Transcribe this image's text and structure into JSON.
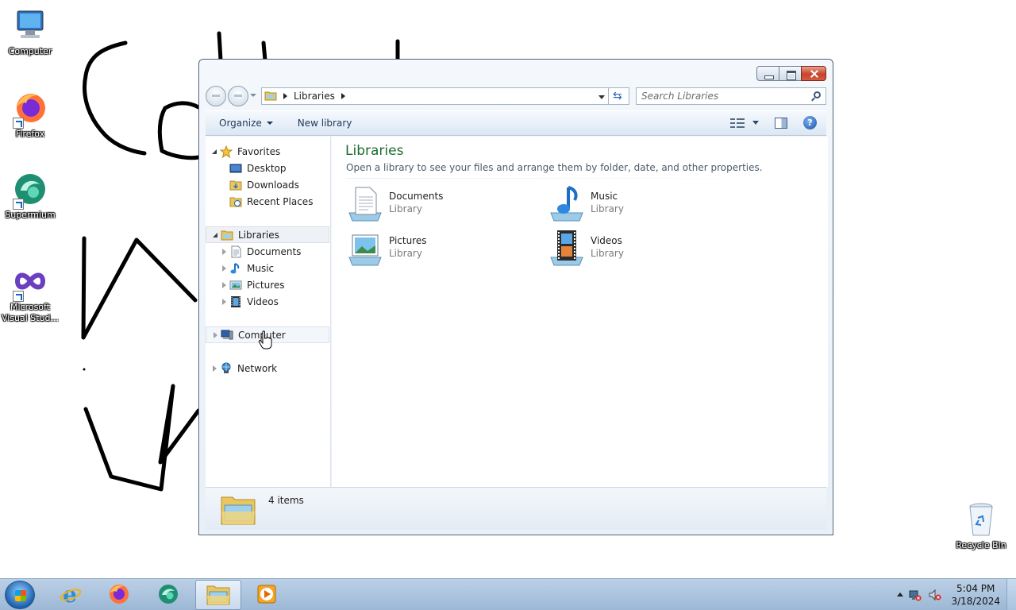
{
  "desktop": {
    "icons": [
      {
        "label": "Computer",
        "icon": "computer-icon"
      },
      {
        "label": "Firefox",
        "icon": "firefox-icon"
      },
      {
        "label": "Supermium",
        "icon": "supermium-icon"
      },
      {
        "label": "Microsoft Visual Stud...",
        "icon": "visual-studio-icon"
      },
      {
        "label": "Recycle Bin",
        "icon": "recycle-bin-icon"
      }
    ]
  },
  "window": {
    "address": {
      "crumb": "Libraries"
    },
    "search": {
      "placeholder": "Search Libraries"
    },
    "toolbar": {
      "organize": "Organize",
      "new_library": "New library"
    },
    "nav": {
      "favorites": "Favorites",
      "favorite_items": [
        "Desktop",
        "Downloads",
        "Recent Places"
      ],
      "libraries": "Libraries",
      "library_items": [
        "Documents",
        "Music",
        "Pictures",
        "Videos"
      ],
      "computer": "Computer",
      "network": "Network"
    },
    "content": {
      "title": "Libraries",
      "subtitle": "Open a library to see your files and arrange them by folder, date, and other properties.",
      "items": [
        {
          "name": "Documents",
          "kind": "Library",
          "icon": "documents-library-icon"
        },
        {
          "name": "Music",
          "kind": "Library",
          "icon": "music-library-icon"
        },
        {
          "name": "Pictures",
          "kind": "Library",
          "icon": "pictures-library-icon"
        },
        {
          "name": "Videos",
          "kind": "Library",
          "icon": "videos-library-icon"
        }
      ]
    },
    "details": {
      "count": "4 items"
    }
  },
  "taskbar": {
    "pinned": [
      "internet-explorer-icon",
      "firefox-icon",
      "supermium-icon",
      "windows-explorer-icon",
      "media-player-icon"
    ],
    "clock": {
      "time": "5:04 PM",
      "date": "3/18/2024"
    }
  },
  "colors": {
    "title_green": "#1e6b2f",
    "close_red": "#c7432c",
    "taskbar": "#a9c2de"
  }
}
